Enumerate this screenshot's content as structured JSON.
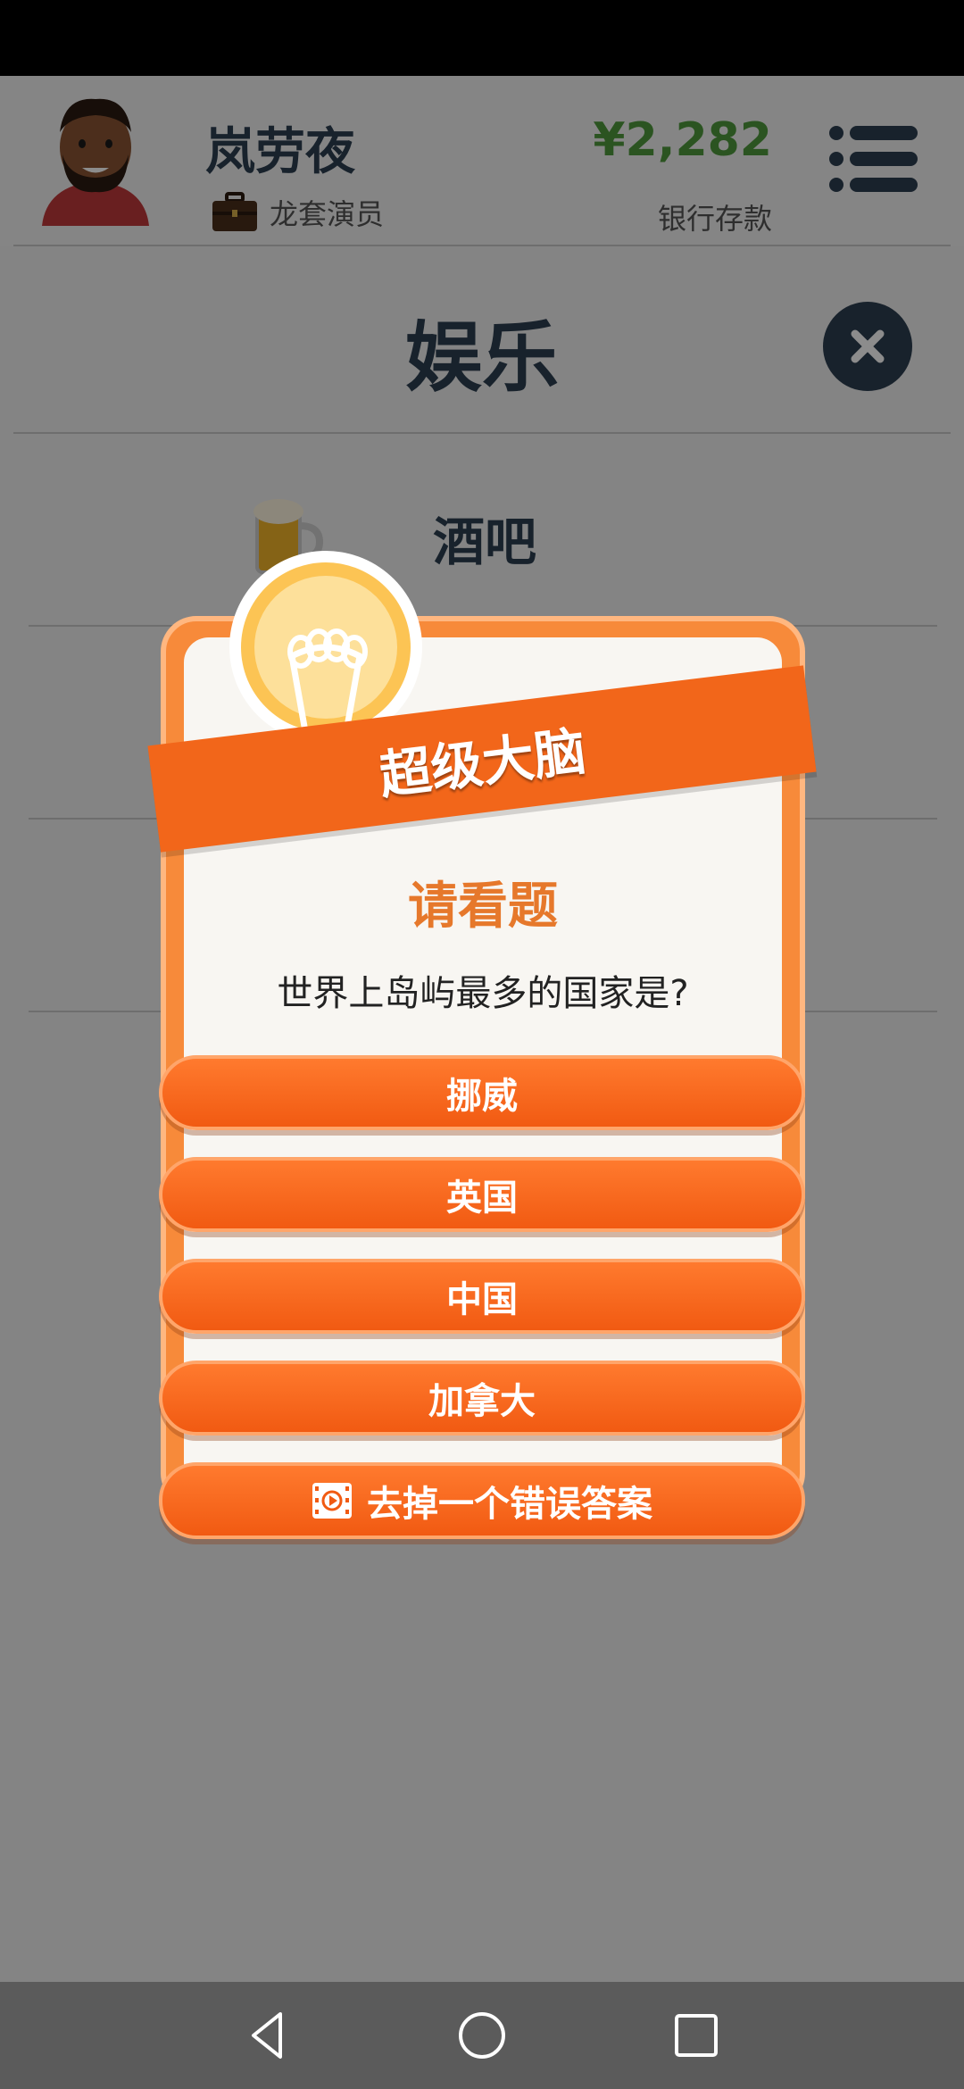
{
  "header": {
    "player_name": "岚劳夜",
    "job": "龙套演员",
    "money": "¥2,282",
    "money_label": "银行存款"
  },
  "page": {
    "title": "娱乐",
    "items": [
      {
        "label": "酒吧",
        "icon": "beer-mug-icon"
      }
    ]
  },
  "quiz": {
    "banner": "超级大脑",
    "prompt": "请看题",
    "question": "世界上岛屿最多的国家是?",
    "answers": [
      "挪威",
      "英国",
      "中国",
      "加拿大"
    ],
    "remove_wrong_label": "去掉一个错误答案"
  },
  "colors": {
    "accent": "#f2661a",
    "money": "#4f9a3d",
    "dark": "#2c3e50"
  }
}
